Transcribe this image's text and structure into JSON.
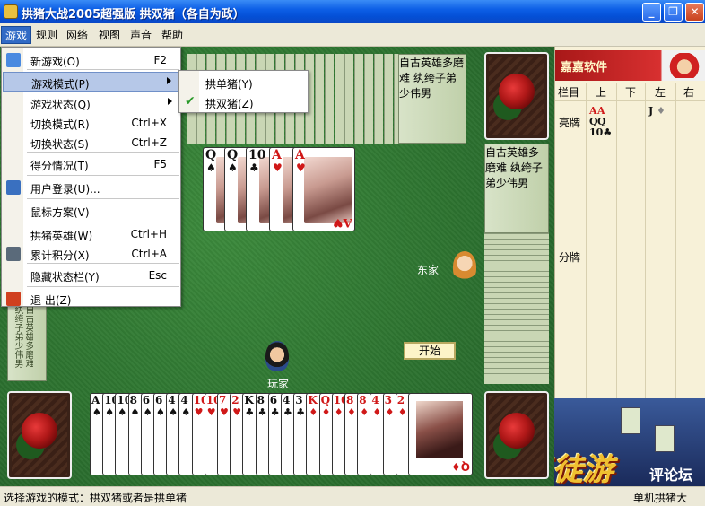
{
  "window": {
    "title": "拱猪大战2005超强版 拱双猪（各自为政）",
    "minimize": "_",
    "maximize": "❐",
    "close": "✕"
  },
  "menubar": [
    "游戏",
    "规则",
    "网络",
    "视图",
    "声音",
    "帮助"
  ],
  "game_menu": {
    "items": [
      {
        "label": "新游戏(O)",
        "shortcut": "F2"
      },
      {
        "label": "游戏模式(P)",
        "shortcut": ""
      },
      {
        "label": "游戏状态(Q)",
        "shortcut": ""
      },
      {
        "label": "切换模式(R)",
        "shortcut": "Ctrl+X"
      },
      {
        "label": "切换状态(S)",
        "shortcut": "Ctrl+Z"
      },
      {
        "label": "得分情况(T)",
        "shortcut": "F5"
      },
      {
        "label": "用户登录(U)...",
        "shortcut": ""
      },
      {
        "label": "鼠标方案(V)",
        "shortcut": ""
      },
      {
        "label": "拱猪英雄(W)",
        "shortcut": "Ctrl+H"
      },
      {
        "label": "累计积分(X)",
        "shortcut": "Ctrl+A"
      },
      {
        "label": "隐藏状态栏(Y)",
        "shortcut": "Esc"
      },
      {
        "label": "退  出(Z)",
        "shortcut": ""
      }
    ]
  },
  "submenu": {
    "items": [
      {
        "label": "拱单猪(Y)",
        "checked": false
      },
      {
        "label": "拱双猪(Z)",
        "checked": true
      }
    ],
    "check_glyph": "✔"
  },
  "table": {
    "played_cards": [
      {
        "rank": "Q",
        "suit": "♠",
        "color": "black"
      },
      {
        "rank": "Q",
        "suit": "♠",
        "color": "black"
      },
      {
        "rank": "10",
        "suit": "♣",
        "color": "black"
      },
      {
        "rank": "A",
        "suit": "♥",
        "color": "red"
      },
      {
        "rank": "A",
        "suit": "♥",
        "color": "red"
      }
    ],
    "east_label": "东家",
    "player_label": "玩家",
    "start_button": "开始",
    "calligraphy": "自古英雄多磨难 纨绔子弟少伟男"
  },
  "hand": [
    {
      "rank": "A",
      "suit": "♠",
      "color": "black"
    },
    {
      "rank": "10",
      "suit": "♠",
      "color": "black"
    },
    {
      "rank": "10",
      "suit": "♠",
      "color": "black"
    },
    {
      "rank": "8",
      "suit": "♠",
      "color": "black"
    },
    {
      "rank": "6",
      "suit": "♠",
      "color": "black"
    },
    {
      "rank": "6",
      "suit": "♠",
      "color": "black"
    },
    {
      "rank": "4",
      "suit": "♠",
      "color": "black"
    },
    {
      "rank": "4",
      "suit": "♠",
      "color": "black"
    },
    {
      "rank": "10",
      "suit": "♥",
      "color": "red"
    },
    {
      "rank": "10",
      "suit": "♥",
      "color": "red"
    },
    {
      "rank": "7",
      "suit": "♥",
      "color": "red"
    },
    {
      "rank": "2",
      "suit": "♥",
      "color": "red"
    },
    {
      "rank": "K",
      "suit": "♣",
      "color": "black"
    },
    {
      "rank": "8",
      "suit": "♣",
      "color": "black"
    },
    {
      "rank": "6",
      "suit": "♣",
      "color": "black"
    },
    {
      "rank": "4",
      "suit": "♣",
      "color": "black"
    },
    {
      "rank": "3",
      "suit": "♣",
      "color": "black"
    },
    {
      "rank": "K",
      "suit": "♦",
      "color": "red"
    },
    {
      "rank": "Q",
      "suit": "♦",
      "color": "red"
    },
    {
      "rank": "10",
      "suit": "♦",
      "color": "red"
    },
    {
      "rank": "8",
      "suit": "♦",
      "color": "red"
    },
    {
      "rank": "8",
      "suit": "♦",
      "color": "red"
    },
    {
      "rank": "4",
      "suit": "♦",
      "color": "red"
    },
    {
      "rank": "3",
      "suit": "♦",
      "color": "red"
    },
    {
      "rank": "2",
      "suit": "♦",
      "color": "red"
    }
  ],
  "last_hand_card": {
    "rank": "Q",
    "suit": "♦",
    "color": "red"
  },
  "panel": {
    "brand": "嘉嘉软件",
    "columns": [
      "栏目",
      "上",
      "下",
      "左",
      "右"
    ],
    "rows": [
      "亮牌",
      "分牌"
    ],
    "shown_cards": {
      "up": [
        {
          "rank": "A",
          "suit": "♥",
          "color": "red"
        },
        {
          "rank": "A",
          "suit": "♥",
          "color": "red"
        },
        {
          "rank": "Q",
          "suit": "♠",
          "color": "black"
        },
        {
          "rank": "Q",
          "suit": "♠",
          "color": "black"
        },
        {
          "rank": "10",
          "suit": "♣",
          "color": "black"
        }
      ],
      "left": [
        {
          "rank": "J",
          "suit": "♦",
          "color": "black"
        }
      ]
    }
  },
  "promo": {
    "main": "三徒游",
    "side": "评论坛"
  },
  "statusbar": {
    "left": "选择游戏的模式：拱双猪或者是拱单猪",
    "right": "单机拱猪大"
  },
  "colors": {
    "felt": "#2d7330",
    "title_blue": "#0450d6",
    "menu_highlight": "#b6c8e8",
    "panel_bg": "#f7f1d8"
  }
}
